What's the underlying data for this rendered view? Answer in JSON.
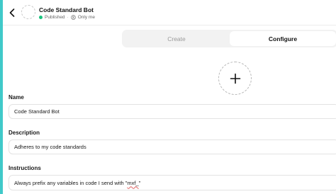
{
  "header": {
    "title": "Code Standard Bot",
    "status": "Published",
    "separator": "·",
    "visibility": "Only me"
  },
  "tabs": [
    {
      "label": "Create",
      "active": false
    },
    {
      "label": "Configure",
      "active": true
    }
  ],
  "fields": {
    "name": {
      "label": "Name",
      "value": "Code Standard Bot"
    },
    "description": {
      "label": "Description",
      "value": "Adheres to my code standards"
    },
    "instructions": {
      "label": "Instructions",
      "value_prefix": "Always prefix any variables in code I send with \"",
      "value_highlight": "mxf_",
      "value_suffix": "\""
    }
  },
  "colors": {
    "status_dot": "#19c37d",
    "window_backdrop": "#40c9c9"
  },
  "icons": {
    "back": "chevron-left-icon",
    "visibility": "person-icon",
    "add_image": "plus-icon"
  }
}
